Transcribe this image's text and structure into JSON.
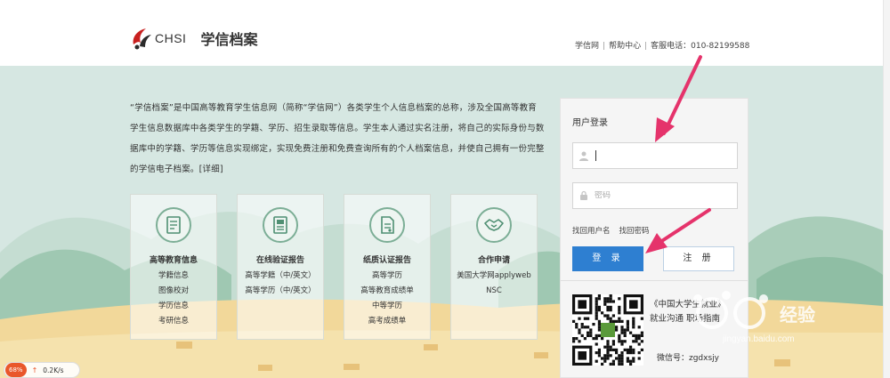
{
  "header": {
    "logo_text": "CHSI",
    "site_title": "学信档案",
    "links": [
      "学信网",
      "帮助中心"
    ],
    "hotline": "客服电话：010-82199588"
  },
  "intro": {
    "text": "“学信档案”是中国高等教育学生信息网（简称“学信网”）各类学生个人信息档案的总称，涉及全国高等教育学生信息数据库中各类学生的学籍、学历、招生录取等信息。学生本人通过实名注册，将自己的实际身份与数据库中的学籍、学历等信息实现绑定，实现免费注册和免费查询所有的个人档案信息，并使自己拥有一份完整的学信电子档案。",
    "more_link": "[详细]"
  },
  "cards": [
    {
      "title": "高等教育信息",
      "items": [
        "学籍信息",
        "图像校对",
        "学历信息",
        "考研信息"
      ],
      "icon": "certificate-icon"
    },
    {
      "title": "在线验证报告",
      "items": [
        "高等学籍（中/英文）",
        "高等学历（中/英文）"
      ],
      "icon": "report-icon"
    },
    {
      "title": "纸质认证报告",
      "items": [
        "高等学历",
        "高等教育成绩单",
        "中等学历",
        "高考成绩单"
      ],
      "icon": "paper-report-icon"
    },
    {
      "title": "合作申请",
      "items": [
        "美国大学网applyweb",
        "NSC"
      ],
      "icon": "handshake-icon"
    }
  ],
  "login": {
    "title": "用户登录",
    "username_value": "",
    "password_placeholder": "密码",
    "forgot_username": "找回用户名",
    "forgot_password": "找回密码",
    "login_button": "登 录",
    "register_button": "注 册",
    "app_name": "《中国大学生就业》",
    "app_desc": "就业沟通  职场指南",
    "wechat": "微信号：zgdxsjy"
  },
  "watermark": {
    "brand": "经验",
    "url": "jingyan.baidu.com"
  },
  "speed_widget": {
    "percent": "68%",
    "speed": "0.2K/s"
  },
  "colors": {
    "accent_blue": "#2e7fd1",
    "arrow_pink": "#e5336b",
    "hero_bg": "#d6e7e2",
    "sand": "#f2d89a"
  }
}
